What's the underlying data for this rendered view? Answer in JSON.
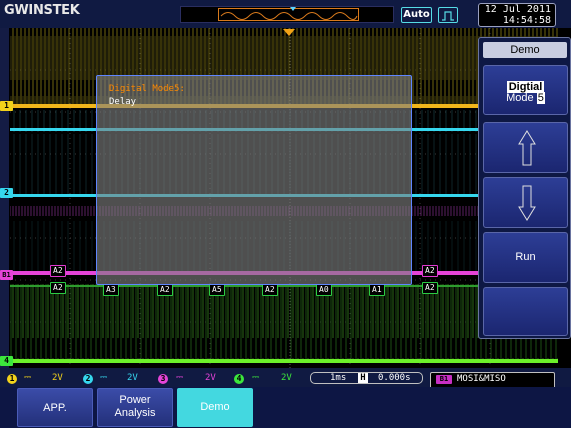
{
  "brand": "GWINSTEK",
  "header": {
    "trigger_mode": "Auto",
    "trigger_type_icon": "rising-edge-pulse-icon",
    "date": "12 Jul 2011",
    "time": "14:54:58"
  },
  "channel_markers": [
    "1",
    "2",
    "B1",
    "4"
  ],
  "dialog": {
    "title": "Digital Mode5:",
    "text": "Delay"
  },
  "bus_decode": {
    "row1_labels": [
      "A2",
      "A2"
    ],
    "row2_labels": [
      "A2",
      "A3",
      "A2",
      "A5",
      "A2",
      "A0",
      "A1",
      "A2"
    ]
  },
  "side_menu": {
    "title": "Demo",
    "mode_label": "Digtial",
    "mode_prefix": "Mode",
    "mode_value": "5",
    "up_icon": "arrow-up-icon",
    "down_icon": "arrow-down-icon",
    "run_label": "Run"
  },
  "status": {
    "channels": [
      {
        "num": "1",
        "coupling": "⎓",
        "scale": "2V",
        "color": "#f2d21b"
      },
      {
        "num": "2",
        "coupling": "⎓",
        "scale": "2V",
        "color": "#36d7ee"
      },
      {
        "num": "3",
        "coupling": "⎓",
        "scale": "2V",
        "color": "#e544d8"
      },
      {
        "num": "4",
        "coupling": "⎓",
        "scale": "2V",
        "color": "#3ce63c"
      }
    ],
    "timebase": "1ms",
    "h_icon": "H",
    "h_position": "0.000s",
    "bus_badge": "B1",
    "bus_name": "MOSI&MISO"
  },
  "bottom_menu": {
    "app": "APP.",
    "power_line1": "Power",
    "power_line2": "Analysis",
    "demo": "Demo"
  },
  "colors": {
    "ch1": "#f2d21b",
    "ch2": "#36d7ee",
    "bus": "#e544d8",
    "ch4": "#3ce63c",
    "digital": "#2ccc44",
    "accent": "#43d8e0"
  }
}
